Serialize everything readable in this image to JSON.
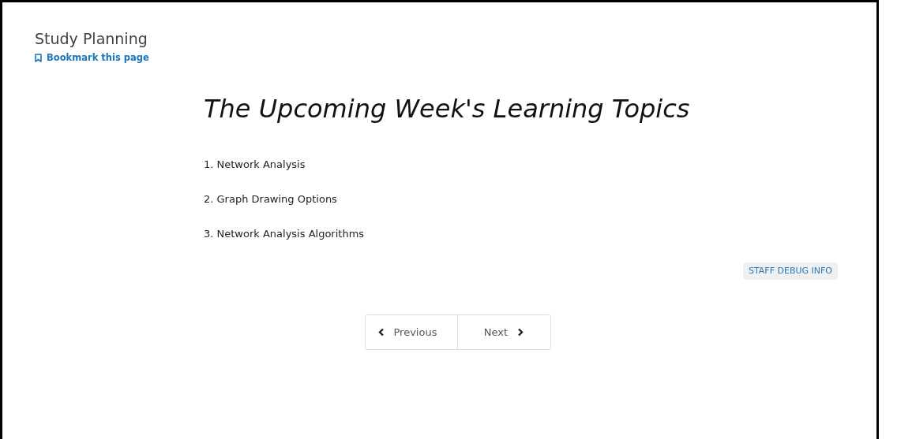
{
  "header": {
    "title": "Study Planning",
    "bookmark_link": "Bookmark this page"
  },
  "heading": "The Upcoming Week's Learning Topics",
  "topics": [
    "1. Network Analysis",
    "2. Graph Drawing Options",
    "3. Network Analysis Algorithms"
  ],
  "debug_button": "STAFF DEBUG INFO",
  "navigation": {
    "previous": "Previous",
    "next": "Next"
  }
}
